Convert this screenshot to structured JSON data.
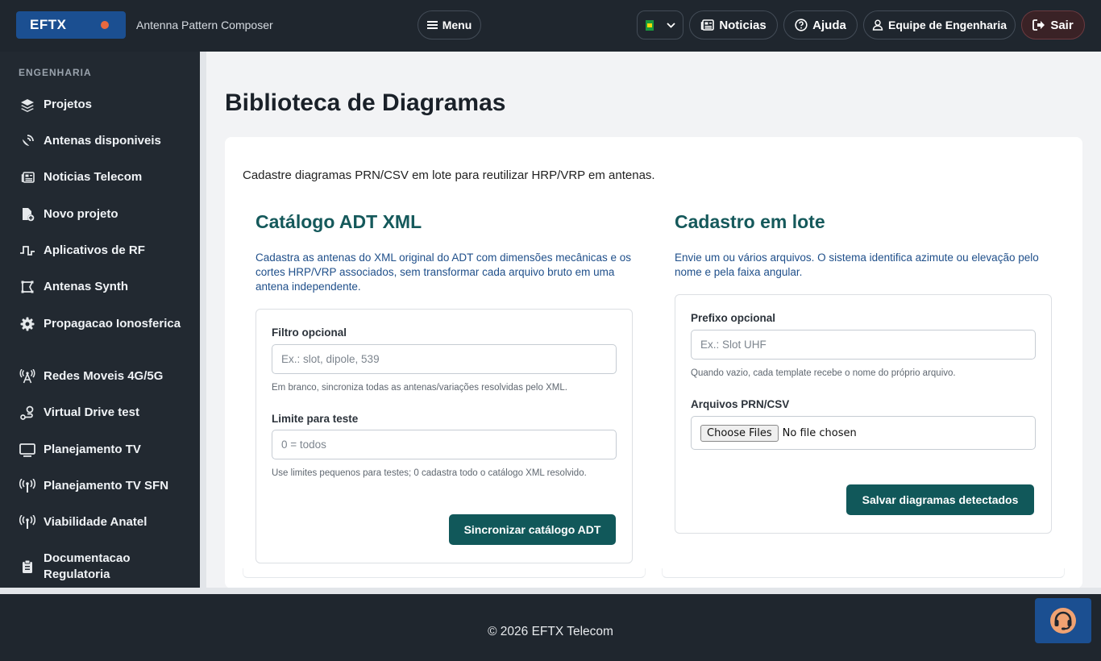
{
  "brand": {
    "name": "EFTX",
    "subtitle": "Antenna Pattern Composer",
    "dot_color": "#e8693f"
  },
  "header": {
    "menu_label": "Menu",
    "language": {
      "selected": "pt-BR",
      "icon": "brazil-flag-icon"
    },
    "news_label": "Noticias",
    "help_label": "Ajuda",
    "user_label": "Equipe de Engenharia",
    "logout_label": "Sair"
  },
  "sidebar": {
    "heading": "ENGENHARIA",
    "items": [
      {
        "label": "Projetos",
        "icon": "layers-icon"
      },
      {
        "label": "Antenas disponiveis",
        "icon": "satellite-dish-icon"
      },
      {
        "label": "Noticias Telecom",
        "icon": "newspaper-icon"
      },
      {
        "label": "Novo projeto",
        "icon": "file-plus-icon"
      },
      {
        "label": "Aplicativos de RF",
        "icon": "pulse-wave-icon"
      },
      {
        "label": "Antenas Synth",
        "icon": "vector-shape-icon"
      },
      {
        "label": "Propagacao Ionosferica",
        "icon": "gear-icon"
      },
      {
        "label": "Redes Moveis 4G/5G",
        "icon": "radio-tower-icon"
      },
      {
        "label": "Virtual Drive test",
        "icon": "route-icon"
      },
      {
        "label": "Planejamento TV",
        "icon": "monitor-icon"
      },
      {
        "label": "Planejamento TV SFN",
        "icon": "broadcast-icon"
      },
      {
        "label": "Viabilidade Anatel",
        "icon": "broadcast-icon"
      },
      {
        "label": "Documentacao Regulatoria",
        "icon": "clipboard-icon"
      }
    ]
  },
  "main": {
    "title": "Biblioteca de Diagramas",
    "intro": "Cadastre diagramas PRN/CSV em lote para reutilizar HRP/VRP em antenas.",
    "catalog": {
      "title": "Catálogo ADT XML",
      "description": "Cadastra as antenas do XML original do ADT com dimensões mecânicas e os cortes HRP/VRP associados, sem transformar cada arquivo bruto em uma antena independente.",
      "filter_label": "Filtro opcional",
      "filter_placeholder": "Ex.: slot, dipole, 539",
      "filter_help": "Em branco, sincroniza todas as antenas/variações resolvidas pelo XML.",
      "limit_label": "Limite para teste",
      "limit_placeholder": "0 = todos",
      "limit_help": "Use limites pequenos para testes; 0 cadastra todo o catálogo XML resolvido.",
      "submit_label": "Sincronizar catálogo ADT"
    },
    "batch": {
      "title": "Cadastro em lote",
      "description": "Envie um ou vários arquivos. O sistema identifica azimute ou elevação pelo nome e pela faixa angular.",
      "prefix_label": "Prefixo opcional",
      "prefix_placeholder": "Ex.: Slot UHF",
      "prefix_help": "Quando vazio, cada template recebe o nome do próprio arquivo.",
      "files_label": "Arquivos PRN/CSV",
      "choose_files_label": "Choose Files",
      "no_file_label": "No file chosen",
      "submit_label": "Salvar diagramas detectados"
    }
  },
  "footer": {
    "copyright": "© 2026 EFTX Telecom"
  },
  "support": {
    "icon": "headset-icon"
  },
  "colors": {
    "accent": "#11585a",
    "brand": "#1b4f91",
    "logout": "#3a2226"
  }
}
